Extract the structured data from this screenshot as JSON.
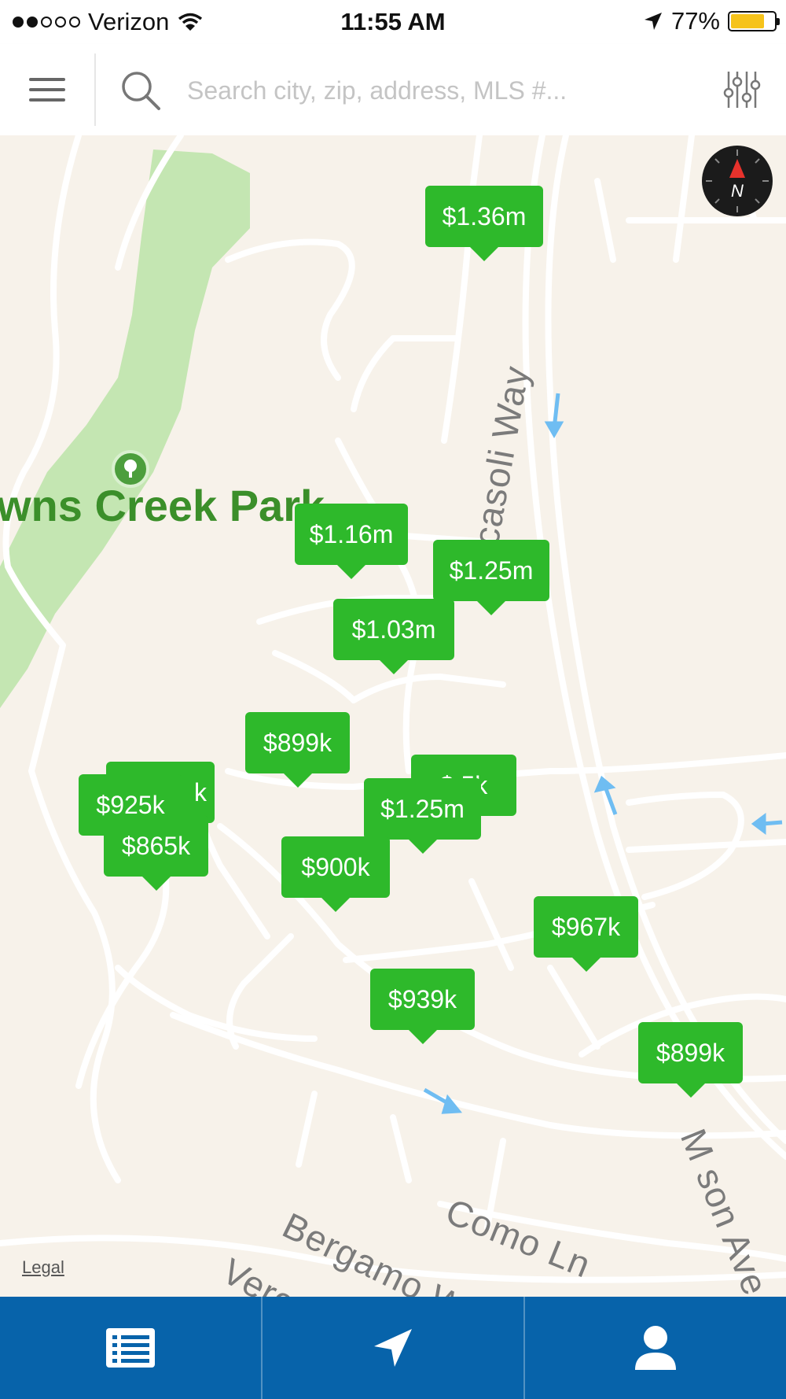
{
  "status_bar": {
    "carrier": "Verizon",
    "time": "11:55 AM",
    "battery_percent": "77%",
    "battery_level": 0.77,
    "signal_bars_filled": 2,
    "signal_bars_total": 5
  },
  "search": {
    "placeholder": "Search city, zip, address, MLS #..."
  },
  "map": {
    "park_label": "wns Creek Park",
    "streets": [
      "Ricasoli Way",
      "Como Ln",
      "Bergamo Way",
      "Vercelli Way",
      "M  son Ave"
    ],
    "legal_link": "Legal",
    "compass_label": "N",
    "partial_labels": [
      "k",
      "$  5k"
    ]
  },
  "listings": [
    {
      "price": "$1.36m"
    },
    {
      "price": "$1.16m"
    },
    {
      "price": "$1.25m"
    },
    {
      "price": "$1.03m"
    },
    {
      "price": "$899k"
    },
    {
      "price": "$925k"
    },
    {
      "price": "$865k"
    },
    {
      "price": "$1.25m"
    },
    {
      "price": "$900k"
    },
    {
      "price": "$967k"
    },
    {
      "price": "$939k"
    },
    {
      "price": "$899k"
    }
  ],
  "tabs": [
    {
      "icon": "list-icon"
    },
    {
      "icon": "navigation-arrow-icon"
    },
    {
      "icon": "user-icon"
    }
  ],
  "colors": {
    "pin_green": "#2eb92b",
    "tabbar_blue": "#0763aa",
    "map_background": "#f7f2ea",
    "park_green": "#c4e6b2",
    "battery_yellow": "#f6c31b"
  }
}
